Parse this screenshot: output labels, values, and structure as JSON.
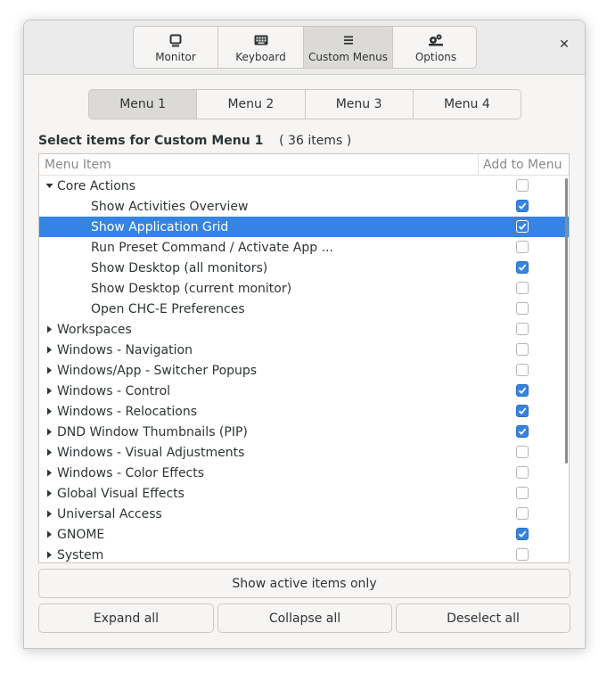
{
  "header": {
    "tabs": [
      {
        "label": "Monitor",
        "icon": "monitor-icon"
      },
      {
        "label": "Keyboard",
        "icon": "keyboard-icon"
      },
      {
        "label": "Custom Menus",
        "icon": "menu-icon"
      },
      {
        "label": "Options",
        "icon": "options-icon"
      }
    ],
    "active_tab": "Custom Menus",
    "close_icon": "close-icon"
  },
  "menu_tabs": {
    "items": [
      "Menu 1",
      "Menu 2",
      "Menu 3",
      "Menu 4"
    ],
    "active": "Menu 1"
  },
  "section": {
    "title": "Select items for Custom Menu 1",
    "count": "( 36 items )"
  },
  "tree": {
    "columns": {
      "item": "Menu Item",
      "add": "Add to Menu"
    },
    "rows": [
      {
        "label": "Core Actions",
        "level": 0,
        "expanded": true,
        "checked": false,
        "selected": false
      },
      {
        "label": "Show Activities Overview",
        "level": 1,
        "checked": true,
        "selected": false
      },
      {
        "label": "Show Application Grid",
        "level": 1,
        "checked": true,
        "selected": true
      },
      {
        "label": "Run Preset Command / Activate App ...",
        "level": 1,
        "checked": false,
        "selected": false
      },
      {
        "label": "Show Desktop (all monitors)",
        "level": 1,
        "checked": true,
        "selected": false
      },
      {
        "label": "Show Desktop (current monitor)",
        "level": 1,
        "checked": false,
        "selected": false
      },
      {
        "label": "Open CHC-E Preferences",
        "level": 1,
        "checked": false,
        "selected": false
      },
      {
        "label": "Workspaces",
        "level": 0,
        "expanded": false,
        "checked": false,
        "selected": false
      },
      {
        "label": "Windows - Navigation",
        "level": 0,
        "expanded": false,
        "checked": false,
        "selected": false
      },
      {
        "label": "Windows/App - Switcher Popups",
        "level": 0,
        "expanded": false,
        "checked": false,
        "selected": false
      },
      {
        "label": "Windows - Control",
        "level": 0,
        "expanded": false,
        "checked": true,
        "selected": false
      },
      {
        "label": "Windows - Relocations",
        "level": 0,
        "expanded": false,
        "checked": true,
        "selected": false
      },
      {
        "label": "DND Window Thumbnails (PIP)",
        "level": 0,
        "expanded": false,
        "checked": true,
        "selected": false
      },
      {
        "label": "Windows - Visual Adjustments",
        "level": 0,
        "expanded": false,
        "checked": false,
        "selected": false
      },
      {
        "label": "Windows - Color Effects",
        "level": 0,
        "expanded": false,
        "checked": false,
        "selected": false
      },
      {
        "label": "Global Visual Effects",
        "level": 0,
        "expanded": false,
        "checked": false,
        "selected": false
      },
      {
        "label": "Universal Access",
        "level": 0,
        "expanded": false,
        "checked": false,
        "selected": false
      },
      {
        "label": "GNOME",
        "level": 0,
        "expanded": false,
        "checked": true,
        "selected": false
      },
      {
        "label": "System",
        "level": 0,
        "expanded": false,
        "checked": false,
        "selected": false
      }
    ]
  },
  "buttons": {
    "show_active": "Show active items only",
    "expand_all": "Expand all",
    "collapse_all": "Collapse all",
    "deselect_all": "Deselect all"
  },
  "colors": {
    "accent": "#3584e4",
    "window_bg": "#f6f5f4",
    "header_bg": "#ebebeb"
  }
}
